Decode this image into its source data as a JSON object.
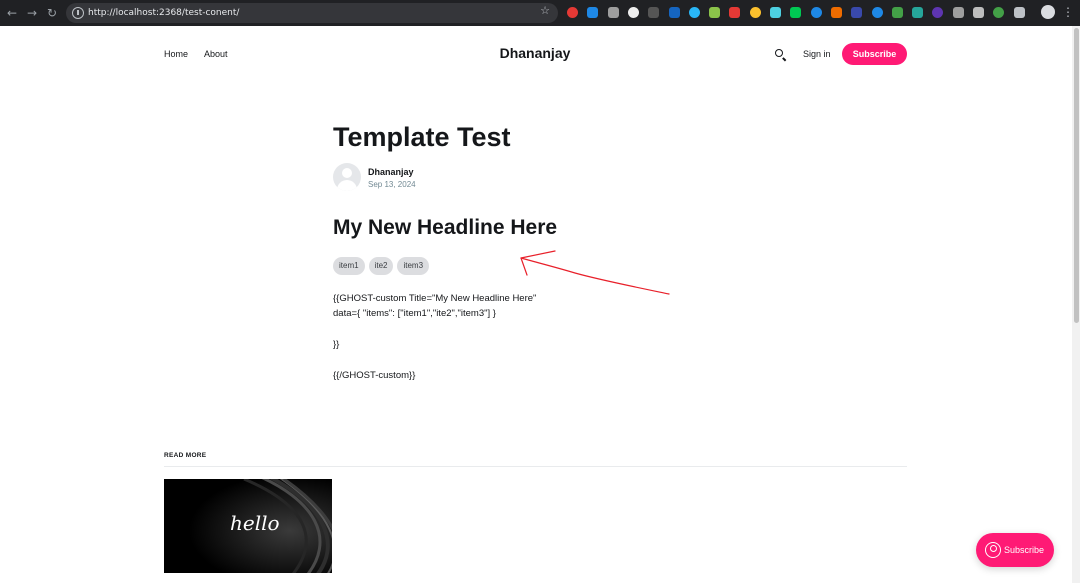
{
  "browser": {
    "url": "http://localhost:2368/test-conent/",
    "extensions": [
      "#e53935",
      "#1e88e5",
      "#9e9e9e",
      "#eeeeee",
      "#555555",
      "#1565c0",
      "#29b6f6",
      "#8bc34a",
      "#e53935",
      "#fbc02d",
      "#4dd0e1",
      "#00c853",
      "#1e88e5",
      "#ef6c00",
      "#3949ab",
      "#1e88e5",
      "#43a047",
      "#26a69a",
      "#5e35b1",
      "#9e9e9e",
      "#bdbdbd",
      "#43a047",
      "#bdc1c6"
    ]
  },
  "header": {
    "nav": [
      "Home",
      "About"
    ],
    "brand": "Dhananjay",
    "signin": "Sign in",
    "subscribe": "Subscribe"
  },
  "article": {
    "title": "Template Test",
    "author": "Dhananjay",
    "date": "Sep 13, 2024",
    "headline": "My New Headline Here",
    "tags": [
      "item1",
      "ite2",
      "item3"
    ],
    "body": [
      "{{GHOST-custom Title=\"My New Headline Here\"",
      "data={ \"items\": [\"item1\",\"ite2\",\"item3\"] }",
      "}}",
      "{{/GHOST-custom}}"
    ]
  },
  "read_more": {
    "heading": "READ MORE",
    "thumbnail_text": "hello"
  },
  "portal": {
    "label": "Subscribe"
  },
  "colors": {
    "accent": "#ff1a75",
    "annotation": "#e8202a"
  }
}
